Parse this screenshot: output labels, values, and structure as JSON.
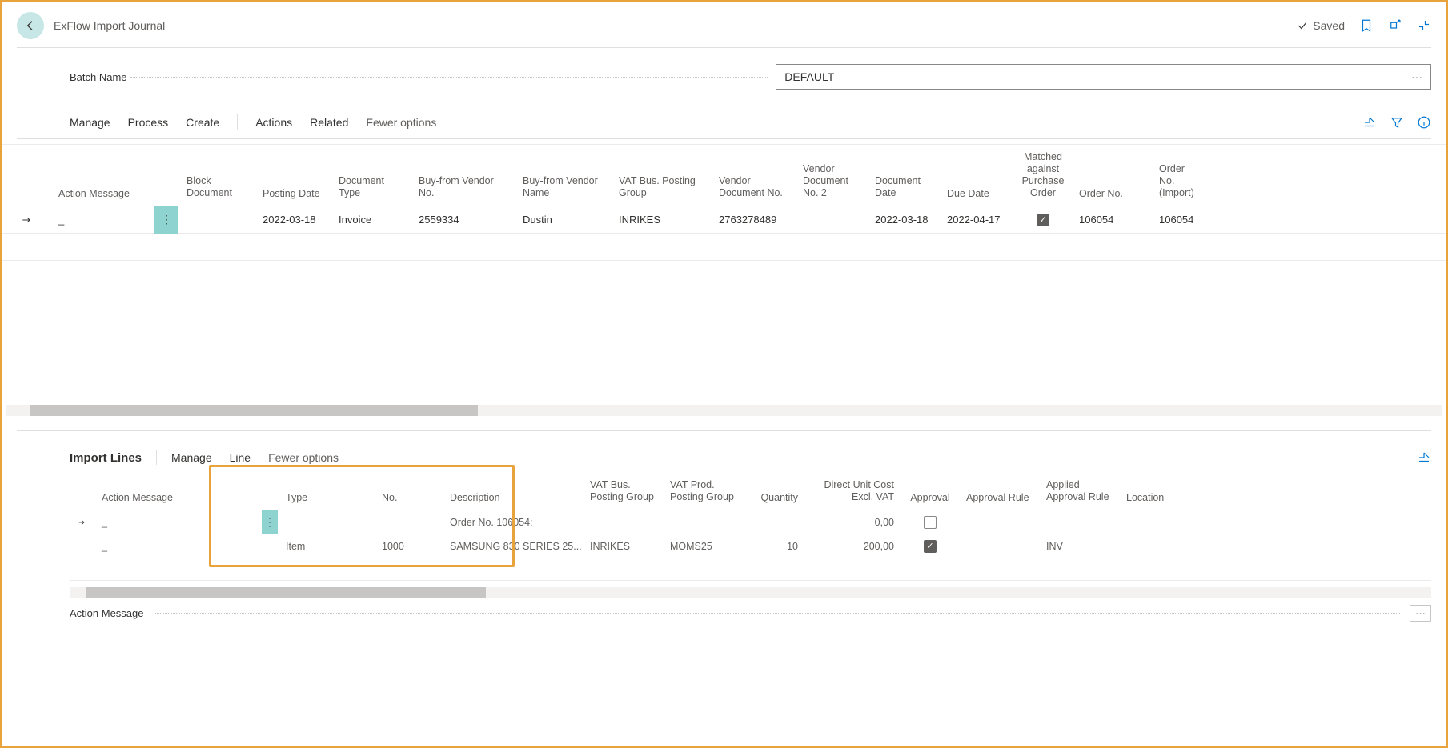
{
  "header": {
    "page_title": "ExFlow Import Journal",
    "saved_label": "Saved"
  },
  "batch": {
    "label": "Batch Name",
    "value": "DEFAULT"
  },
  "toolbar": {
    "tabs1": {
      "manage": "Manage",
      "process": "Process",
      "create": "Create"
    },
    "tabs2": {
      "actions": "Actions",
      "related": "Related",
      "fewer": "Fewer options"
    }
  },
  "grid1": {
    "columns": {
      "action_message": "Action Message",
      "block_doc": "Block Document",
      "posting_date": "Posting Date",
      "doc_type": "Document Type",
      "buy_no": "Buy-from Vendor No.",
      "buy_name": "Buy-from Vendor Name",
      "vat_bus": "VAT Bus. Posting Group",
      "vendor_doc": "Vendor Document No.",
      "vendor_doc2": "Vendor Document No. 2",
      "doc_date": "Document Date",
      "due_date": "Due Date",
      "matched": "Matched against Purchase Order",
      "order_no": "Order No.",
      "order_no_import": "Order No. (Import)"
    },
    "rows": [
      {
        "action_message": "_",
        "block_doc": "",
        "posting_date": "2022-03-18",
        "doc_type": "Invoice",
        "buy_no": "2559334",
        "buy_name": "Dustin",
        "vat_bus": "INRIKES",
        "vendor_doc": "2763278489",
        "vendor_doc2": "",
        "doc_date": "2022-03-18",
        "due_date": "2022-04-17",
        "matched": true,
        "order_no": "106054",
        "order_no_import": "106054"
      }
    ]
  },
  "import_section": {
    "title": "Import Lines",
    "tabs": {
      "manage": "Manage",
      "line": "Line",
      "fewer": "Fewer options"
    }
  },
  "grid2": {
    "columns": {
      "action_message": "Action Message",
      "type": "Type",
      "no": "No.",
      "description": "Description",
      "vat_bus": "VAT Bus. Posting Group",
      "vat_prod": "VAT Prod. Posting Group",
      "quantity": "Quantity",
      "unit_cost": "Direct Unit Cost Excl. VAT",
      "approval": "Approval",
      "approval_rule": "Approval Rule",
      "applied_rule": "Applied Approval Rule",
      "location": "Location"
    },
    "rows": [
      {
        "action_message": "_",
        "type": "",
        "no": "",
        "description": "Order No. 106054:",
        "vat_bus": "",
        "vat_prod": "",
        "quantity": "",
        "unit_cost": "0,00",
        "approval": false,
        "approval_rule": "",
        "applied_rule": "",
        "location": ""
      },
      {
        "action_message": "_",
        "type": "Item",
        "no": "1000",
        "description": "SAMSUNG 830 SERIES 25...",
        "vat_bus": "INRIKES",
        "vat_prod": "MOMS25",
        "quantity": "10",
        "unit_cost": "200,00",
        "approval": true,
        "approval_rule": "",
        "applied_rule": "INV",
        "location": ""
      }
    ]
  },
  "footer": {
    "action_message_label": "Action Message",
    "more": "···"
  }
}
